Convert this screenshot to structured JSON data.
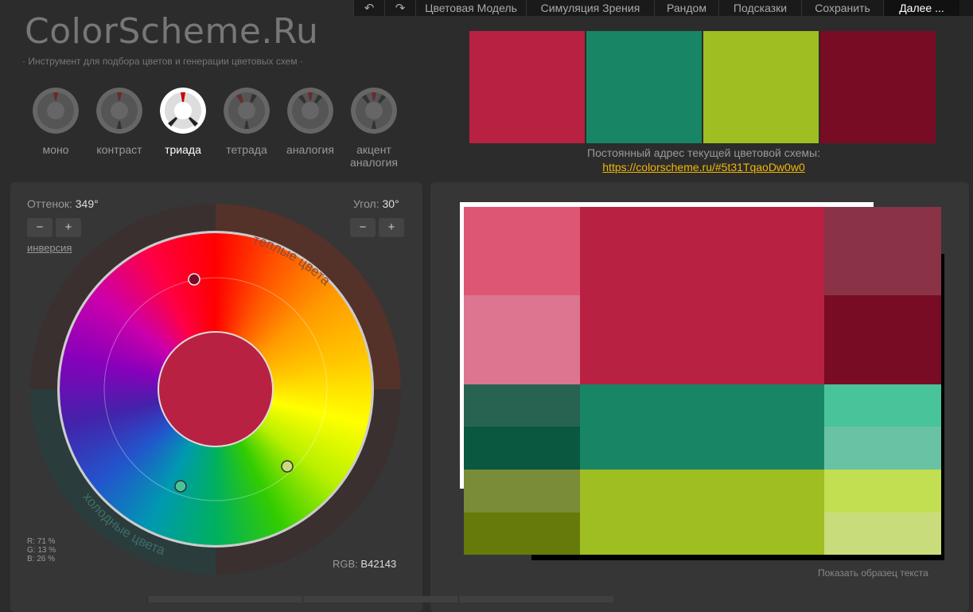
{
  "nav": {
    "undo_icon": "undo-icon",
    "redo_icon": "redo-icon",
    "items": [
      "Цветовая Модель",
      "Симуляция Зрения",
      "Рандом",
      "Подсказки",
      "Сохранить",
      "Далее ..."
    ]
  },
  "logo": "ColorScheme.Ru",
  "tagline": "· Инструмент для подбора цветов и генерации цветовых схем ·",
  "modes": [
    "моно",
    "контраст",
    "триада",
    "тетрада",
    "аналогия",
    "акцент аналогия"
  ],
  "active_mode": "триада",
  "palette": [
    "#B82142",
    "#188665",
    "#9EBE21",
    "#780C24"
  ],
  "permalink": {
    "label": "Постоянный адрес текущей цветовой схемы:",
    "url": "https://colorscheme.ru/#5t31TqaoDw0w0"
  },
  "hue": {
    "label": "Оттенок:",
    "value": "349°"
  },
  "angle": {
    "label": "Угол:",
    "value": "30°"
  },
  "stepper": {
    "minus": "−",
    "plus": "+"
  },
  "inversion": "инверсия",
  "wheel": {
    "warm": "тёплые цвета",
    "cold": "холодные цвета",
    "center_color": "#B82142"
  },
  "rgb": {
    "label": "RGB:",
    "value": "B42143"
  },
  "percent": {
    "r": "R: 71 %",
    "g": "G: 13 %",
    "b": "B: 26 %"
  },
  "sample_text": "Показать образец текста",
  "preview_colors": {
    "primary": [
      "#DD5673",
      "#DC7690",
      "#B82142",
      "#8A3347",
      "#780C24"
    ],
    "second": [
      "#286352",
      "#09583F",
      "#188665",
      "#49C39A",
      "#69C2A3"
    ],
    "third": [
      "#7A8C37",
      "#657A0B",
      "#9EBE21",
      "#C1DF50",
      "#C9DC7B"
    ]
  },
  "colors": {
    "bg": "#2C2C2C",
    "panel": "#363636",
    "link": "#F2B705"
  }
}
